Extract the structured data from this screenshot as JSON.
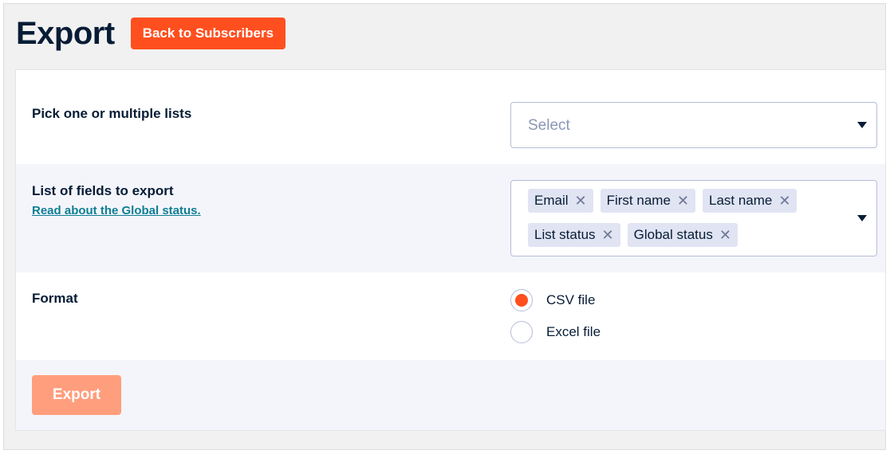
{
  "header": {
    "title": "Export",
    "back_button": "Back to Subscribers"
  },
  "lists_row": {
    "label": "Pick one or multiple lists",
    "select_placeholder": "Select"
  },
  "fields_row": {
    "label": "List of fields to export",
    "help_link": "Read about the Global status.",
    "tags": [
      "Email",
      "First name",
      "Last name",
      "List status",
      "Global status"
    ]
  },
  "format_row": {
    "label": "Format",
    "options": [
      {
        "label": "CSV file",
        "checked": true
      },
      {
        "label": "Excel file",
        "checked": false
      }
    ]
  },
  "footer": {
    "export_button": "Export"
  },
  "colors": {
    "accent": "#ff4f1f",
    "accent_disabled": "#ff9e7d",
    "text_dark": "#071c35",
    "link": "#0e7e93"
  }
}
